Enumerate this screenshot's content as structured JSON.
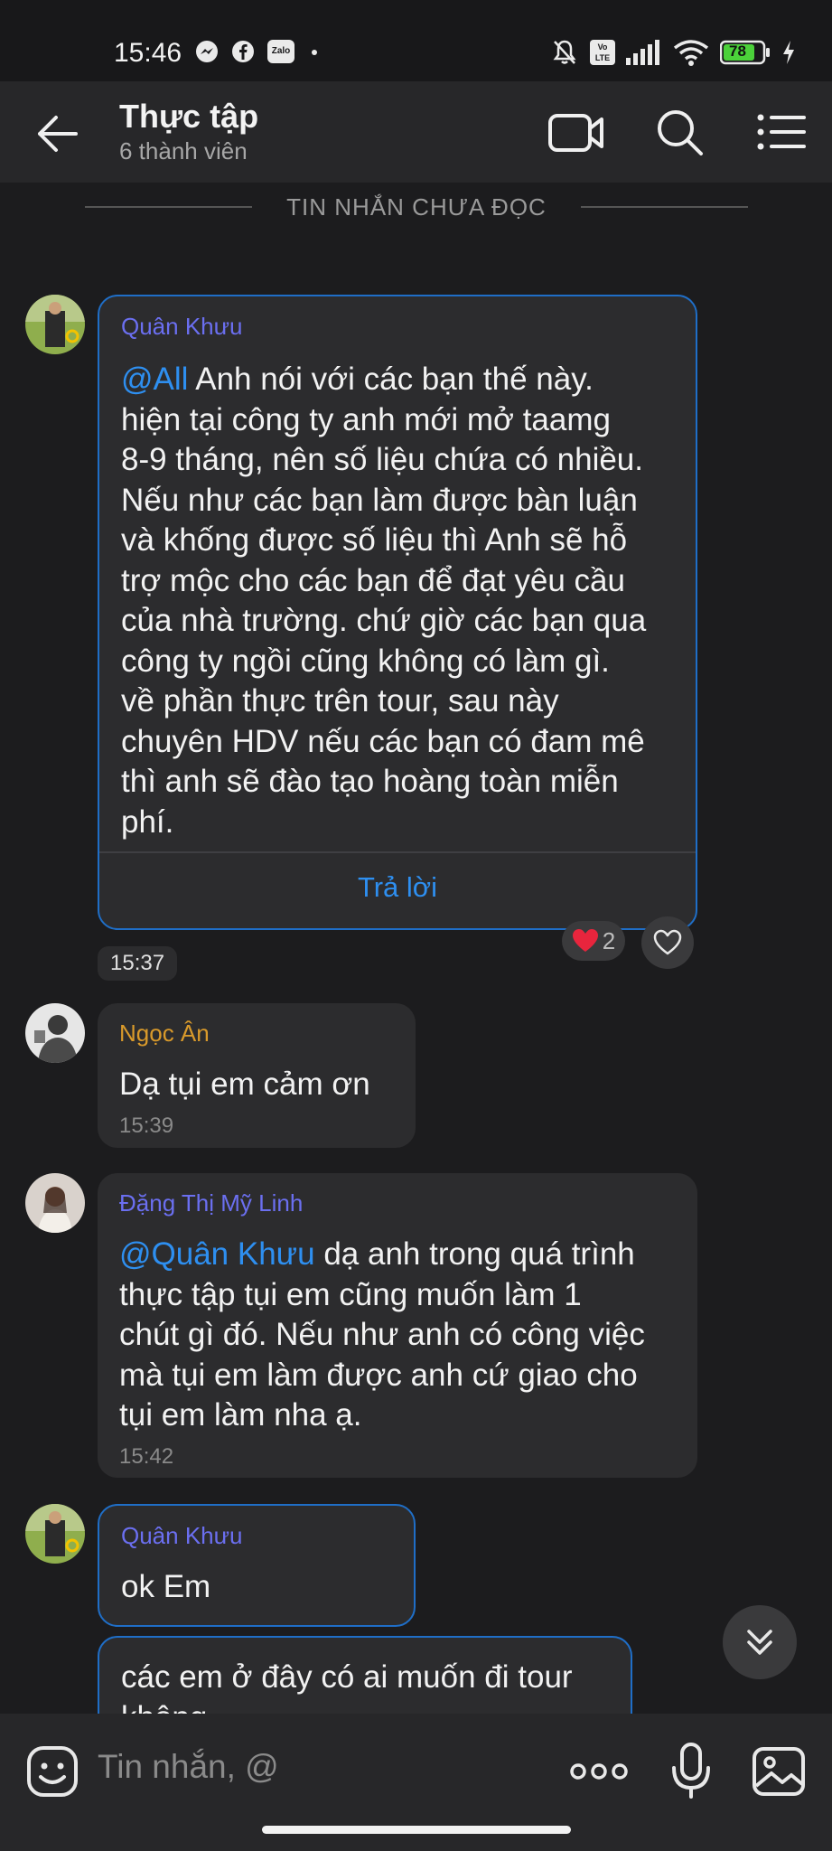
{
  "status_bar": {
    "time": "15:46",
    "battery": "78",
    "icons": [
      "messenger-icon",
      "facebook-icon",
      "zalo-icon",
      "dot-icon",
      "mute-icon",
      "volte-icon",
      "signal-icon",
      "wifi-icon",
      "battery-icon",
      "charging-icon"
    ],
    "zalo_label": "Zalo",
    "volte_label": "Vo LTE"
  },
  "header": {
    "title": "Thực tập",
    "subtitle": "6 thành viên",
    "icons": [
      "back-arrow-icon",
      "video-call-icon",
      "search-icon",
      "menu-list-icon"
    ]
  },
  "unread_divider": "TIN NHẮN CHƯA ĐỌC",
  "messages": [
    {
      "sender": "Quân Khưu",
      "sender_color": "#6b6ff0",
      "mention": "@All",
      "lines": [
        " Anh nói với các bạn thế này.",
        "hiện tại công ty anh mới mở taamg",
        "8-9 tháng, nên số liệu chứa có nhiều.",
        "Nếu như các bạn làm được bàn luận",
        "và khống được số liệu thì Anh sẽ hỗ",
        "trợ mộc cho các bạn để đạt yêu cầu",
        "của nhà trường. chứ giờ các bạn qua",
        "công ty ngồi cũng không có làm gì.",
        "về phần thực trên tour, sau này",
        "chuyên HDV nếu các bạn có đam mê",
        "thì anh sẽ đào tạo hoàng toàn miễn",
        "phí."
      ],
      "reply_label": "Trả lời",
      "reaction_emoji": "❤",
      "reaction_count": "2",
      "time": "15:37"
    },
    {
      "sender": "Ngọc Ân",
      "sender_color": "#d99a2b",
      "text": "Dạ tụi em cảm ơn",
      "time": "15:39"
    },
    {
      "sender": "Đặng Thị Mỹ Linh",
      "sender_color": "#6b6ff0",
      "mention": "@Quân Khưu",
      "lines": [
        " dạ anh trong quá trình",
        "thực tập tụi em cũng muốn làm 1",
        "chút gì đó. Nếu như anh có công việc",
        "mà tụi em làm được anh cứ giao cho",
        "tụi em làm nha ạ."
      ],
      "time": "15:42"
    },
    {
      "sender": "Quân Khưu",
      "sender_color": "#6b6ff0",
      "text": "ok Em"
    },
    {
      "text": "các em ở đây có ai muốn đi tour",
      "text_cut": "không"
    }
  ],
  "composer": {
    "placeholder": "Tin nhắn, @",
    "icons": [
      "emoji-icon",
      "more-dots-icon",
      "microphone-icon",
      "image-icon"
    ]
  },
  "colors": {
    "background": "#1c1c1e",
    "bubble": "#2c2c2e",
    "accent_blue": "#2e8ff0",
    "own_border": "#1f6ec7"
  }
}
